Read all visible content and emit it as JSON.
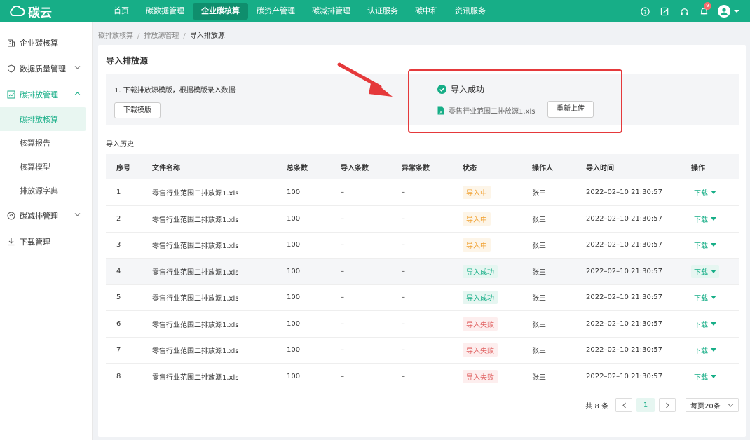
{
  "app": {
    "logo_text": "碳云"
  },
  "topnav": {
    "items": [
      {
        "label": "首页"
      },
      {
        "label": "碳数据管理"
      },
      {
        "label": "企业碳核算",
        "active": true
      },
      {
        "label": "碳资产管理"
      },
      {
        "label": "碳减排管理"
      },
      {
        "label": "认证服务"
      },
      {
        "label": "碳中和"
      },
      {
        "label": "资讯服务"
      }
    ],
    "notification_count": "9",
    "icons": [
      "help-icon",
      "edit-icon",
      "headset-icon",
      "bell-icon",
      "user-avatar-icon"
    ]
  },
  "sidebar": {
    "items": [
      {
        "label": "企业碳核算",
        "icon": "building-icon"
      },
      {
        "label": "数据质量管理",
        "icon": "shield-icon"
      },
      {
        "label": "碳排放管理",
        "icon": "chart-icon",
        "open": true
      },
      {
        "label": "碳减排管理",
        "icon": "leaf-icon"
      },
      {
        "label": "下载管理",
        "icon": "download-icon"
      }
    ],
    "subitems": [
      {
        "label": "碳排放核算",
        "active": true
      },
      {
        "label": "核算报告"
      },
      {
        "label": "核算模型"
      },
      {
        "label": "排放源字典"
      }
    ]
  },
  "breadcrumb": [
    "碳排放核算",
    "排放源管理",
    "导入排放源"
  ],
  "page": {
    "title": "导入排放源",
    "step_text": "1. 下载排放源模版，根据模版录入数据",
    "download_template_label": "下载模版",
    "result": {
      "status": "导入成功",
      "file_name": "零售行业范围二排放源1.xls",
      "reupload_label": "重新上传"
    },
    "history_label": "导入历史"
  },
  "table": {
    "columns": [
      "序号",
      "文件名称",
      "总条数",
      "导入条数",
      "异常条数",
      "状态",
      "操作人",
      "导入时间",
      "操作"
    ],
    "rows": [
      {
        "no": "1",
        "file": "零售行业范围二排放源1.xls",
        "total": "100",
        "imported": "–",
        "abnormal": "–",
        "status": "导入中",
        "status_type": "loading",
        "operator": "张三",
        "time": "2022–02–10 21:30:57",
        "action": "下载"
      },
      {
        "no": "2",
        "file": "零售行业范围二排放源1.xls",
        "total": "100",
        "imported": "–",
        "abnormal": "–",
        "status": "导入中",
        "status_type": "loading",
        "operator": "张三",
        "time": "2022–02–10 21:30:57",
        "action": "下载"
      },
      {
        "no": "3",
        "file": "零售行业范围二排放源1.xls",
        "total": "100",
        "imported": "–",
        "abnormal": "–",
        "status": "导入中",
        "status_type": "loading",
        "operator": "张三",
        "time": "2022–02–10 21:30:57",
        "action": "下载"
      },
      {
        "no": "4",
        "file": "零售行业范围二排放源1.xls",
        "total": "100",
        "imported": "–",
        "abnormal": "–",
        "status": "导入成功",
        "status_type": "success",
        "operator": "张三",
        "time": "2022–02–10 21:30:57",
        "action": "下载",
        "highlight": true
      },
      {
        "no": "5",
        "file": "零售行业范围二排放源1.xls",
        "total": "100",
        "imported": "–",
        "abnormal": "–",
        "status": "导入成功",
        "status_type": "success",
        "operator": "张三",
        "time": "2022–02–10 21:30:57",
        "action": "下载"
      },
      {
        "no": "6",
        "file": "零售行业范围二排放源1.xls",
        "total": "100",
        "imported": "–",
        "abnormal": "–",
        "status": "导入失败",
        "status_type": "fail",
        "operator": "张三",
        "time": "2022–02–10 21:30:57",
        "action": "下载"
      },
      {
        "no": "7",
        "file": "零售行业范围二排放源1.xls",
        "total": "100",
        "imported": "–",
        "abnormal": "–",
        "status": "导入失败",
        "status_type": "fail",
        "operator": "张三",
        "time": "2022–02–10 21:30:57",
        "action": "下载"
      },
      {
        "no": "8",
        "file": "零售行业范围二排放源1.xls",
        "total": "100",
        "imported": "–",
        "abnormal": "–",
        "status": "导入失败",
        "status_type": "fail",
        "operator": "张三",
        "time": "2022–02–10 21:30:57",
        "action": "下载"
      }
    ]
  },
  "pagination": {
    "total_text": "共 8 条",
    "current_page": "1",
    "page_size_text": "每页20条"
  },
  "colors": {
    "brand": "#17ae87",
    "annotation": "#e5393b"
  }
}
